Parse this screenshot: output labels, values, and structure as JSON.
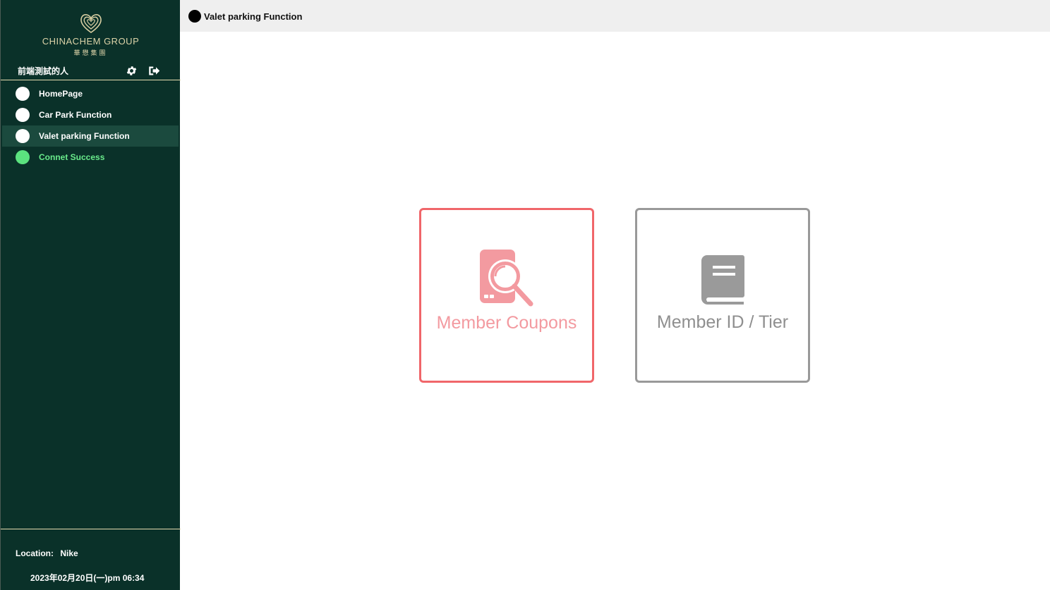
{
  "brand": {
    "name_en": "CHINACHEM GROUP",
    "name_zh": "華懋集團"
  },
  "user": {
    "name": "前端測試的人"
  },
  "sidebar": {
    "items": [
      {
        "label": "HomePage"
      },
      {
        "label": "Car Park Function"
      },
      {
        "label": "Valet parking Function"
      },
      {
        "label": "Connet Success"
      }
    ]
  },
  "footer": {
    "location_label": "Location:",
    "location_value": "Nike",
    "datetime": "2023年02月20日(一)pm 06:34"
  },
  "header": {
    "title": "Valet parking Function"
  },
  "cards": [
    {
      "label": "Member Coupons",
      "icon": "coupon-search-icon"
    },
    {
      "label": "Member ID / Tier",
      "icon": "book-icon"
    }
  ],
  "colors": {
    "sidebar_bg": "#0a3129",
    "sidebar_active": "#1b4a3e",
    "gold_accent": "#dcd3a8",
    "status_green": "#5be27f",
    "coupon_accent": "#f0666a",
    "member_accent": "#999999"
  }
}
